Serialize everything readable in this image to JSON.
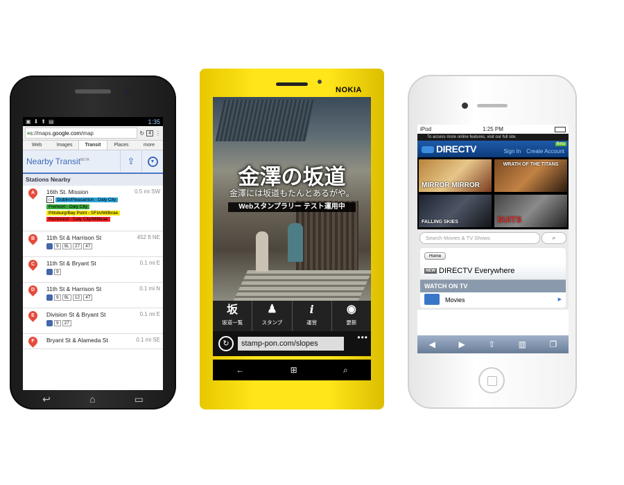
{
  "android": {
    "status_time": "1:35",
    "url_prefix": "s://maps.",
    "url_domain": "google.com",
    "url_suffix": "/map",
    "tab_count": "4",
    "tabs": [
      "Web",
      "Images",
      "Transit",
      "Places",
      "more"
    ],
    "header_title": "Nearby Transit",
    "header_beta": "BETA",
    "section_title": "Stations Nearby",
    "stops": [
      {
        "letter": "A",
        "name": "16th St. Mission",
        "distance": "0.5 mi SW",
        "routes": [
          {
            "label": "Dublin/Pleasanton - Daly City",
            "color": "#2ea3d8"
          },
          {
            "label": "Fremont - Daly City",
            "color": "#38a83a"
          },
          {
            "label": "Pittsburg/Bay Point - SFIA/Millbrae",
            "color": "#f5e600"
          },
          {
            "label": "Richmond - Daly City/Millbrae",
            "color": "#ee2222"
          }
        ]
      },
      {
        "letter": "B",
        "name": "11th St & Harrison St",
        "distance": "452 ft NE",
        "lines": [
          "9",
          "9L",
          "27",
          "47"
        ]
      },
      {
        "letter": "C",
        "name": "11th St & Bryant St",
        "distance": "0.1 mi E",
        "lines": [
          "9"
        ]
      },
      {
        "letter": "D",
        "name": "11th St & Harrison St",
        "distance": "0.1 mi N",
        "lines": [
          "9",
          "9L",
          "12",
          "47"
        ]
      },
      {
        "letter": "E",
        "name": "Division St & Bryant St",
        "distance": "0.1 mi E",
        "lines": [
          "9",
          "27"
        ]
      },
      {
        "letter": "F",
        "name": "Bryant St & Alameda St",
        "distance": "0.1 mi SE"
      }
    ]
  },
  "nokia": {
    "brand": "NOKIA",
    "title": "金澤の坂道",
    "subtitle": "金澤には坂道もたんとあるがや。",
    "banner": "Webスタンプラリー テスト運用中",
    "menu": [
      {
        "icon": "坂",
        "label": "坂道一覧"
      },
      {
        "icon": "♟",
        "label": "スタンプ"
      },
      {
        "icon": "i",
        "label": "運営"
      },
      {
        "icon": "◉",
        "label": "更新"
      }
    ],
    "url": "stamp-pon.com/slopes",
    "more_dots": "•••"
  },
  "iphone": {
    "carrier": "iPod",
    "time": "1:25 PM",
    "promo": "To access more online features, visit our full site.",
    "logo": "DIRECTV",
    "beta": "Beta",
    "sign_in": "Sign In",
    "create_account": "Create Account",
    "tiles": [
      "MIRROR MIRROR",
      "WRATH OF THE TITANS",
      "FALLING SKIES",
      "SUITS"
    ],
    "search_placeholder": "Search Movies & TV Shows",
    "home_button": "Home",
    "new_badge": "NEW",
    "everywhere": "DIRECTV Everywhere",
    "watch_on_tv": "WATCH ON TV",
    "movies": "Movies"
  }
}
